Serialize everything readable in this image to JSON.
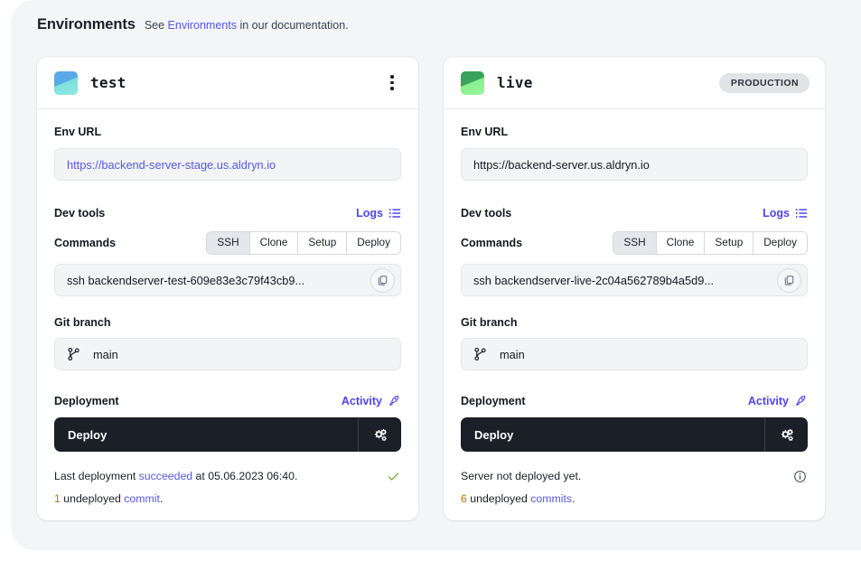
{
  "header": {
    "title": "Environments",
    "subtitle_prefix": "See ",
    "subtitle_link": "Environments",
    "subtitle_suffix": " in our documentation."
  },
  "colors": {
    "accent": "#5558e3",
    "panel_bg": "#f4f5f7",
    "card_bg": "#ffffff",
    "deploy_bar": "#1b1f27",
    "warn": "#c2700e",
    "success": "#7aa832",
    "test_swatch": "#5aa7e8",
    "live_swatch": "#38a05a"
  },
  "labels": {
    "env_url": "Env URL",
    "dev_tools": "Dev tools",
    "logs": "Logs",
    "commands": "Commands",
    "git_branch": "Git branch",
    "deployment": "Deployment",
    "activity": "Activity",
    "deploy": "Deploy"
  },
  "command_tabs": [
    "SSH",
    "Clone",
    "Setup",
    "Deploy"
  ],
  "cards": [
    {
      "name": "test",
      "swatch": "test-gradient-icon",
      "menu_icon": "kebab-menu-icon",
      "badge": null,
      "env_url": "https://backend-server-stage.us.aldryn.io",
      "env_url_is_link": true,
      "active_tab": "SSH",
      "command": "ssh backendserver-test-609e83e3c79f43cb9...",
      "git_branch": "main",
      "status": {
        "line1_prefix": "Last deployment ",
        "line1_state": "succeeded",
        "line1_suffix": " at 05.06.2023 06:40.",
        "line1_icon": "check-icon",
        "count": "1",
        "count_label": " undeployed ",
        "count_link": "commit",
        "count_suffix": "."
      }
    },
    {
      "name": "live",
      "swatch": "live-gradient-icon",
      "menu_icon": null,
      "badge": "PRODUCTION",
      "env_url": "https://backend-server.us.aldryn.io",
      "env_url_is_link": false,
      "active_tab": "SSH",
      "command": "ssh backendserver-live-2c04a562789b4a5d9...",
      "git_branch": "main",
      "status": {
        "line1_prefix": "Server not deployed yet.",
        "line1_state": "",
        "line1_suffix": "",
        "line1_icon": "info-icon",
        "count": "6",
        "count_label": " undeployed ",
        "count_link": "commits",
        "count_suffix": "."
      }
    }
  ]
}
